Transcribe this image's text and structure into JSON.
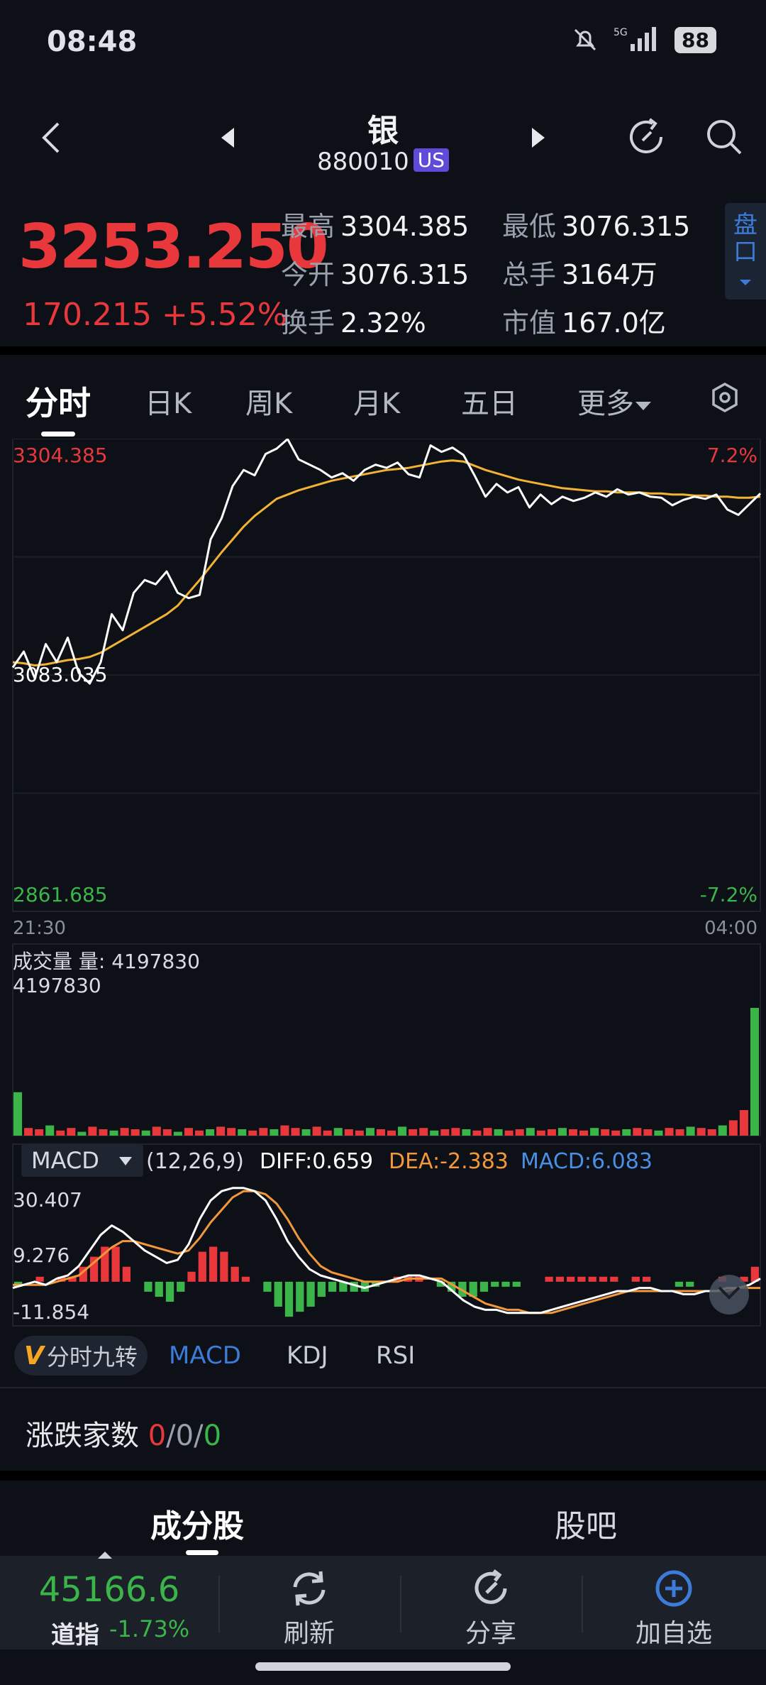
{
  "status_bar": {
    "time": "08:48",
    "network": "5G",
    "battery": "88",
    "icons": [
      "mute-bell-icon",
      "signal-5g-icon",
      "battery-icon"
    ]
  },
  "header": {
    "title": "银",
    "code": "880010",
    "market_badge": "US",
    "icons": [
      "back-icon",
      "prev-icon",
      "next-icon",
      "refresh-icon",
      "search-icon"
    ]
  },
  "quote": {
    "price": "3253.250",
    "change": "170.215",
    "change_pct": "+5.52%",
    "high_label": "最高",
    "high": "3304.385",
    "low_label": "最低",
    "low": "3076.315",
    "open_label": "今开",
    "open": "3076.315",
    "volume_label": "总手",
    "volume": "3164万",
    "turnover_label": "换手",
    "turnover": "2.32%",
    "mktcap_label": "市值",
    "mktcap": "167.0亿",
    "pankou_label": "盘口"
  },
  "chart_tabs": {
    "items": [
      "分时",
      "日K",
      "周K",
      "月K",
      "五日",
      "更多"
    ],
    "active": "分时",
    "settings_icon": "gear-icon"
  },
  "chart_data": {
    "type": "line",
    "price_axis": {
      "top": "3304.385",
      "mid": "3083.035",
      "bottom": "2861.685",
      "top_pct": "7.2%",
      "bottom_pct": "-7.2%"
    },
    "time_axis": {
      "start": "21:30",
      "end": "04:00"
    },
    "ylim": [
      2861.685,
      3304.385
    ],
    "series": [
      {
        "values": [
          3090,
          3105,
          3080,
          3112,
          3095,
          3118,
          3085,
          3075,
          3095,
          3140,
          3125,
          3160,
          3172,
          3168,
          3180,
          3160,
          3155,
          3158,
          3210,
          3230,
          3260,
          3275,
          3270,
          3290,
          3295,
          3304,
          3285,
          3280,
          3275,
          3268,
          3272,
          3265,
          3275,
          3280,
          3277,
          3282,
          3271,
          3268,
          3298,
          3292,
          3296,
          3289,
          3270,
          3250,
          3262,
          3254,
          3259,
          3240,
          3252,
          3243,
          3250,
          3246,
          3249,
          3254,
          3250,
          3257,
          3252,
          3254,
          3250,
          3249,
          3242,
          3247,
          3250,
          3248,
          3252,
          3238,
          3233,
          3243,
          3253
        ]
      },
      {
        "values": [
          3095,
          3094,
          3092,
          3093,
          3095,
          3097,
          3098,
          3100,
          3104,
          3110,
          3116,
          3122,
          3128,
          3134,
          3140,
          3148,
          3160,
          3172,
          3185,
          3198,
          3210,
          3222,
          3232,
          3240,
          3248,
          3252,
          3256,
          3259,
          3262,
          3265,
          3267,
          3269,
          3271,
          3273,
          3275,
          3276,
          3277,
          3279,
          3281,
          3283,
          3284,
          3283,
          3279,
          3275,
          3272,
          3269,
          3266,
          3264,
          3262,
          3260,
          3258,
          3257,
          3256,
          3255,
          3255,
          3254,
          3254,
          3254,
          3253,
          3253,
          3252,
          3252,
          3251,
          3251,
          3250,
          3250,
          3249,
          3249,
          3250
        ]
      }
    ],
    "volume": {
      "title": "成交量",
      "label": "量: 4197830",
      "max": "4197830",
      "values": [
        0.34,
        0.06,
        0.05,
        0.08,
        0.04,
        0.06,
        0.03,
        0.07,
        0.05,
        0.04,
        0.06,
        0.05,
        0.04,
        0.07,
        0.05,
        0.03,
        0.06,
        0.04,
        0.05,
        0.07,
        0.06,
        0.05,
        0.04,
        0.06,
        0.05,
        0.08,
        0.06,
        0.05,
        0.07,
        0.04,
        0.06,
        0.05,
        0.04,
        0.06,
        0.05,
        0.04,
        0.07,
        0.05,
        0.06,
        0.04,
        0.05,
        0.06,
        0.05,
        0.04,
        0.06,
        0.05,
        0.04,
        0.05,
        0.06,
        0.04,
        0.05,
        0.06,
        0.05,
        0.04,
        0.06,
        0.05,
        0.04,
        0.05,
        0.06,
        0.05,
        0.04,
        0.06,
        0.05,
        0.07,
        0.06,
        0.05,
        0.08,
        0.12,
        0.2,
        1.0
      ]
    },
    "macd": {
      "selector": "MACD",
      "params": "(12,26,9)",
      "diff_label": "DIFF:0.659",
      "dea_label": "DEA:-2.383",
      "macd_label": "MACD:6.083",
      "y_top": "30.407",
      "y_mid": "9.276",
      "y_bottom": "-11.854",
      "ylim": [
        -11.854,
        30.407
      ],
      "diff": [
        -2,
        -1,
        0,
        -1,
        1,
        2,
        5,
        10,
        15,
        18,
        16,
        13,
        10,
        8,
        6,
        7,
        12,
        20,
        26,
        29,
        30,
        30,
        29,
        26,
        20,
        13,
        8,
        4,
        2,
        1,
        0,
        -1,
        -2,
        -1,
        0,
        1,
        2,
        2,
        1,
        0,
        -3,
        -6,
        -8,
        -9,
        -9,
        -10,
        -10,
        -10,
        -10,
        -9,
        -8,
        -7,
        -6,
        -5,
        -4,
        -3,
        -3,
        -2,
        -2,
        -3,
        -3,
        -4,
        -4,
        -3,
        -3,
        -2,
        -2,
        -1,
        1
      ],
      "dea": [
        -1,
        -1,
        -1,
        -1,
        0,
        1,
        2,
        5,
        8,
        11,
        13,
        13,
        12,
        11,
        10,
        9,
        10,
        14,
        19,
        23,
        27,
        29,
        29,
        28,
        25,
        20,
        14,
        9,
        5,
        3,
        2,
        1,
        0,
        0,
        0,
        0,
        1,
        1,
        1,
        1,
        -1,
        -3,
        -5,
        -7,
        -8,
        -9,
        -9,
        -10,
        -10,
        -10,
        -9,
        -8,
        -7,
        -6,
        -5,
        -4,
        -3,
        -3,
        -3,
        -3,
        -3,
        -3,
        -3,
        -3,
        -3,
        -3,
        -2,
        -2,
        -2
      ],
      "macd": [
        -1,
        0,
        1,
        0,
        1,
        1,
        3,
        5,
        7,
        7,
        3,
        0,
        -2,
        -3,
        -4,
        -2,
        2,
        6,
        7,
        6,
        3,
        1,
        0,
        -2,
        -5,
        -7,
        -6,
        -5,
        -3,
        -2,
        -2,
        -2,
        -2,
        -1,
        0,
        1,
        1,
        1,
        0,
        -1,
        -2,
        -3,
        -3,
        -2,
        -1,
        -1,
        -1,
        0,
        0,
        1,
        1,
        1,
        1,
        1,
        1,
        1,
        0,
        1,
        1,
        0,
        0,
        -1,
        -1,
        0,
        0,
        1,
        0,
        1,
        3
      ]
    }
  },
  "indicator_tabs": {
    "jiuzhuan_mark": "V",
    "jiuzhuan": "分时九转",
    "items": [
      "MACD",
      "KDJ",
      "RSI"
    ],
    "active": "MACD"
  },
  "updown": {
    "label": "涨跌家数",
    "up": "0",
    "flat": "0",
    "down": "0"
  },
  "bottom_tabs": {
    "items": [
      "成分股",
      "股吧"
    ],
    "active": "成分股"
  },
  "toolbar": {
    "index_value": "45166.6",
    "index_name": "道指",
    "index_pct": "-1.73%",
    "refresh": "刷新",
    "share": "分享",
    "add": "加自选"
  },
  "colors": {
    "up": "#e8383c",
    "down": "#3bb54a",
    "accent": "#3d7bd9",
    "avg_line": "#f2b233",
    "dea": "#f2973a"
  }
}
